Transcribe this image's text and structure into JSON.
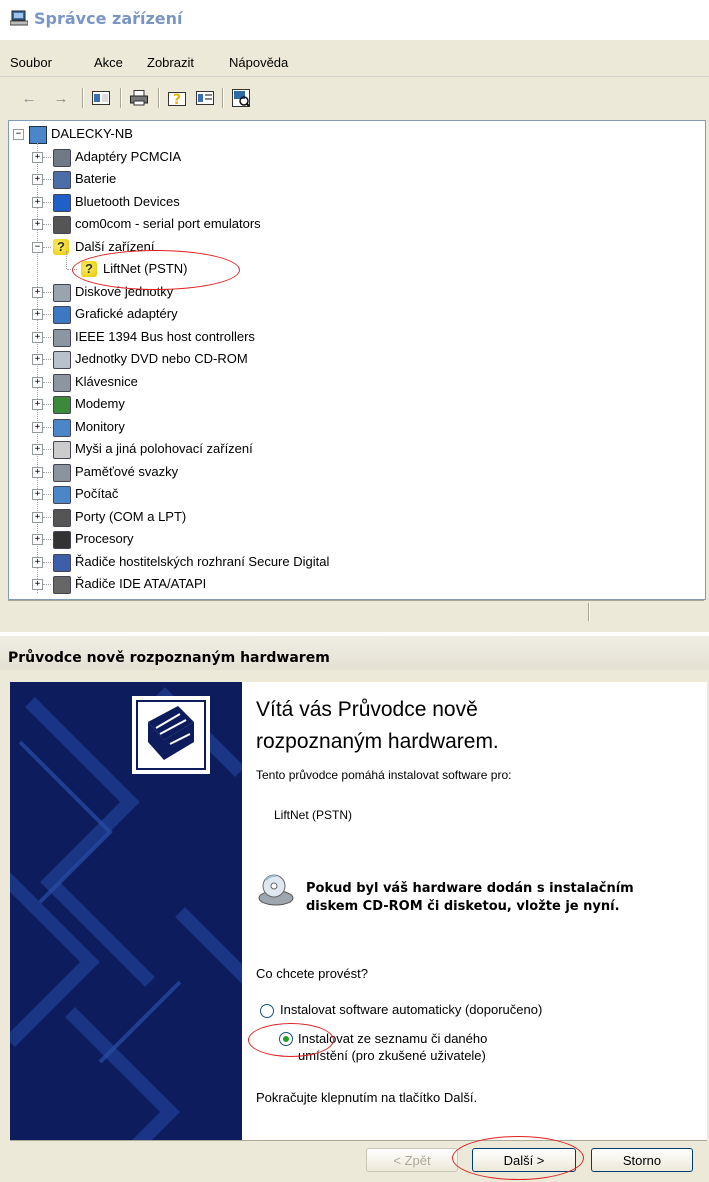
{
  "device_manager": {
    "title": "Správce zařízení",
    "menu": [
      "Soubor",
      "Akce",
      "Zobrazit",
      "Nápověda"
    ],
    "toolbar_icons": [
      "back-icon",
      "forward-icon",
      "properties-pane-icon",
      "print-icon",
      "help-icon",
      "view-icon",
      "scan-hardware-icon"
    ],
    "tree": {
      "root": "DALECKY-NB",
      "items": [
        {
          "label": "Adaptéry PCMCIA",
          "icon": "pcmcia-icon",
          "expanded": false
        },
        {
          "label": "Baterie",
          "icon": "battery-icon",
          "expanded": false
        },
        {
          "label": "Bluetooth Devices",
          "icon": "bluetooth-icon",
          "expanded": false
        },
        {
          "label": "com0com - serial port emulators",
          "icon": "port-icon",
          "expanded": false
        },
        {
          "label": "Další zařízení",
          "icon": "unknown-device-icon",
          "expanded": true
        },
        {
          "label": "LiftNet (PSTN)",
          "icon": "unknown-device-warning-icon",
          "child": true
        },
        {
          "label": "Diskové jednotky",
          "icon": "disk-icon",
          "expanded": false
        },
        {
          "label": "Grafické adaptéry",
          "icon": "display-icon",
          "expanded": false
        },
        {
          "label": "IEEE 1394 Bus host controllers",
          "icon": "ieee1394-icon",
          "expanded": false
        },
        {
          "label": "Jednotky DVD nebo CD-ROM",
          "icon": "cdrom-icon",
          "expanded": false
        },
        {
          "label": "Klávesnice",
          "icon": "keyboard-icon",
          "expanded": false
        },
        {
          "label": "Modemy",
          "icon": "modem-icon",
          "expanded": false
        },
        {
          "label": "Monitory",
          "icon": "monitor-icon",
          "expanded": false
        },
        {
          "label": "Myši a jiná polohovací zařízení",
          "icon": "mouse-icon",
          "expanded": false
        },
        {
          "label": "Paměťové svazky",
          "icon": "volume-icon",
          "expanded": false
        },
        {
          "label": "Počítač",
          "icon": "computer-icon",
          "expanded": false
        },
        {
          "label": "Porty (COM a LPT)",
          "icon": "port-icon",
          "expanded": false
        },
        {
          "label": "Procesory",
          "icon": "processor-icon",
          "expanded": false
        },
        {
          "label": "Řadiče hostitelských rozhraní Secure Digital",
          "icon": "sd-host-icon",
          "expanded": false
        },
        {
          "label": "Řadiče IDE ATA/ATAPI",
          "icon": "ide-icon",
          "expanded": false
        }
      ]
    }
  },
  "wizard": {
    "title": "Průvodce nově rozpoznaným hardwarem",
    "heading_line1": "Vítá vás Průvodce nově",
    "heading_line2": "rozpoznaným hardwarem.",
    "intro": "Tento průvodce pomáhá instalovat software pro:",
    "device": "LiftNet (PSTN)",
    "cd_notice_line1": "Pokud byl váš hardware dodán s instalačním",
    "cd_notice_line2": "diskem CD-ROM či disketou, vložte je nyní.",
    "question": "Co chcete provést?",
    "options": [
      {
        "label": "Instalovat software automaticky (doporučeno)",
        "selected": false
      },
      {
        "label_line1": "Instalovat ze seznamu či daného",
        "label_line2": "umístění (pro zkušené uživatele)",
        "selected": true
      }
    ],
    "continue_hint": "Pokračujte klepnutím na tlačítko Další.",
    "buttons": {
      "back": "< Zpět",
      "next": "Další >",
      "cancel": "Storno"
    }
  },
  "colors": {
    "annotation": "#e02020",
    "wizard_panel": "#0c1c5c",
    "title_text": "#7a96c6"
  }
}
